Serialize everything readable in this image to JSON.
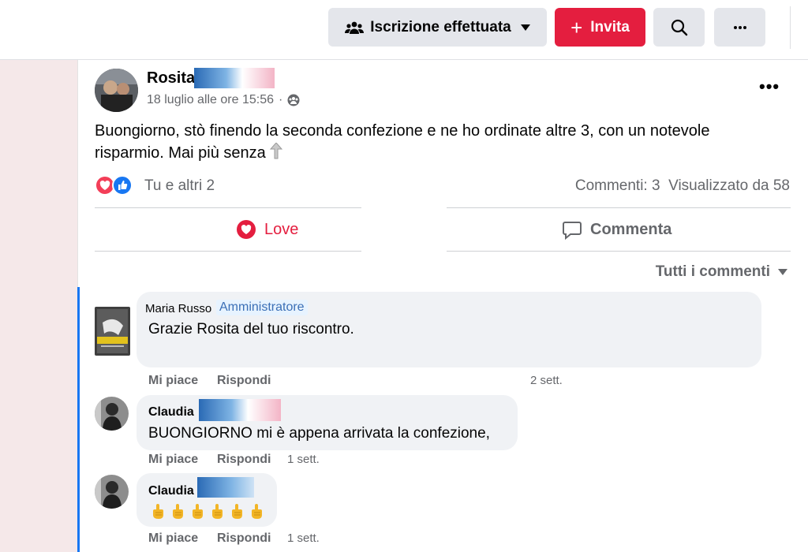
{
  "header": {
    "joined_label": "Iscrizione effettuata",
    "invite_label": "Invita",
    "search_icon": "search-icon",
    "more_icon": "more-horizontal-icon"
  },
  "post": {
    "author": "Rosita",
    "date": "18 luglio alle ore 15:56",
    "privacy_icon": "group-icon",
    "text": "Buongiorno,  stò finendo la seconda confezione e ne ho ordinate altre 3, con un notevole risparmio.  Mai più senza",
    "reactions_label": "Tu e altri 2",
    "comments_label": "Commenti: 3",
    "views_label": "Visualizzato da 58",
    "love_label": "Love",
    "comment_label": "Commenta",
    "sort_label": "Tutti i commenti"
  },
  "comments": [
    {
      "author": "Maria Russo",
      "badge": "Amministratore",
      "text": "Grazie Rosita del tuo riscontro.",
      "like": "Mi piace",
      "reply": "Rispondi",
      "time": "2 sett."
    },
    {
      "author": "Claudia",
      "text": "BUONGIORNO mi è appena arrivata la confezione,",
      "like": "Mi piace",
      "reply": "Rispondi",
      "time": "1 sett."
    },
    {
      "author": "Claudia",
      "text": "",
      "emoji": "👍",
      "emoji_count": 6,
      "like": "Mi piace",
      "reply": "Rispondi",
      "time": "1 sett."
    }
  ],
  "colors": {
    "brand_red": "#e41e3f",
    "link_blue": "#1877f2",
    "muted": "#65676b",
    "bubble": "#f0f2f5"
  }
}
